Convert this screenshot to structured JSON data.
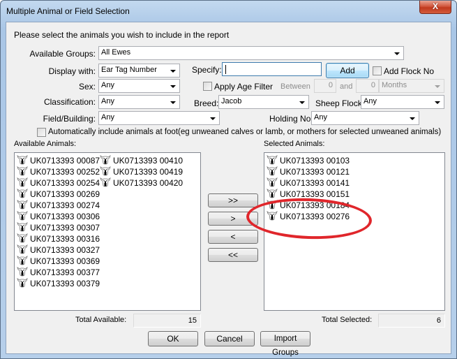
{
  "window": {
    "title": "Multiple Animal or Field Selection",
    "close_label": "X"
  },
  "instruction": "Please select the animals you wish to include in the report",
  "filters": {
    "available_groups": {
      "label": "Available Groups:",
      "value": "All Ewes"
    },
    "display_with": {
      "label": "Display with:",
      "value": "Ear Tag Number"
    },
    "specify": {
      "label": "Specify:",
      "value": ""
    },
    "add_button": "Add",
    "add_flock_no": {
      "label": "Add Flock No",
      "checked": false
    },
    "sex": {
      "label": "Sex:",
      "value": "Any"
    },
    "apply_age_filter": {
      "label": "Apply Age Filter",
      "checked": false
    },
    "between": {
      "label": "Between",
      "from": "0",
      "and_label": "and",
      "to": "0",
      "unit": "Months"
    },
    "classification": {
      "label": "Classification:",
      "value": "Any"
    },
    "breed": {
      "label": "Breed:",
      "value": "Jacob"
    },
    "sheep_flock": {
      "label": "Sheep Flock:",
      "value": "Any"
    },
    "field_building": {
      "label": "Field/Building:",
      "value": "Any"
    },
    "holding_no": {
      "label": "Holding No:",
      "value": "Any"
    },
    "auto_include": {
      "label": "Automatically include animals at foot(eg unweaned calves or lamb, or mothers for selected unweaned animals)",
      "checked": false
    }
  },
  "available": {
    "label": "Available Animals:",
    "icon": "sheep-icon",
    "items": [
      "UK0713393 00087",
      "UK0713393 00252",
      "UK0713393 00254",
      "UK0713393 00269",
      "UK0713393 00274",
      "UK0713393 00306",
      "UK0713393 00307",
      "UK0713393 00316",
      "UK0713393 00327",
      "UK0713393 00369",
      "UK0713393 00377",
      "UK0713393 00379",
      "UK0713393 00410",
      "UK0713393 00419",
      "UK0713393 00420"
    ],
    "total_label": "Total Available:",
    "total": "15"
  },
  "selected": {
    "label": "Selected Animals:",
    "icon": "sheep-icon",
    "items": [
      "UK0713393 00103",
      "UK0713393 00121",
      "UK0713393 00141",
      "UK0713393 00151",
      "UK0713393 00184",
      "UK0713393 00276"
    ],
    "total_label": "Total Selected:",
    "total": "6"
  },
  "transfer_buttons": {
    "add_all": ">>",
    "add_one": ">",
    "remove_one": "<",
    "remove_all": "<<"
  },
  "footer": {
    "ok": "OK",
    "cancel": "Cancel",
    "import_groups": "Import Groups"
  },
  "annotation": {
    "color": "#e0262b",
    "target": "UK0713393 00276"
  }
}
